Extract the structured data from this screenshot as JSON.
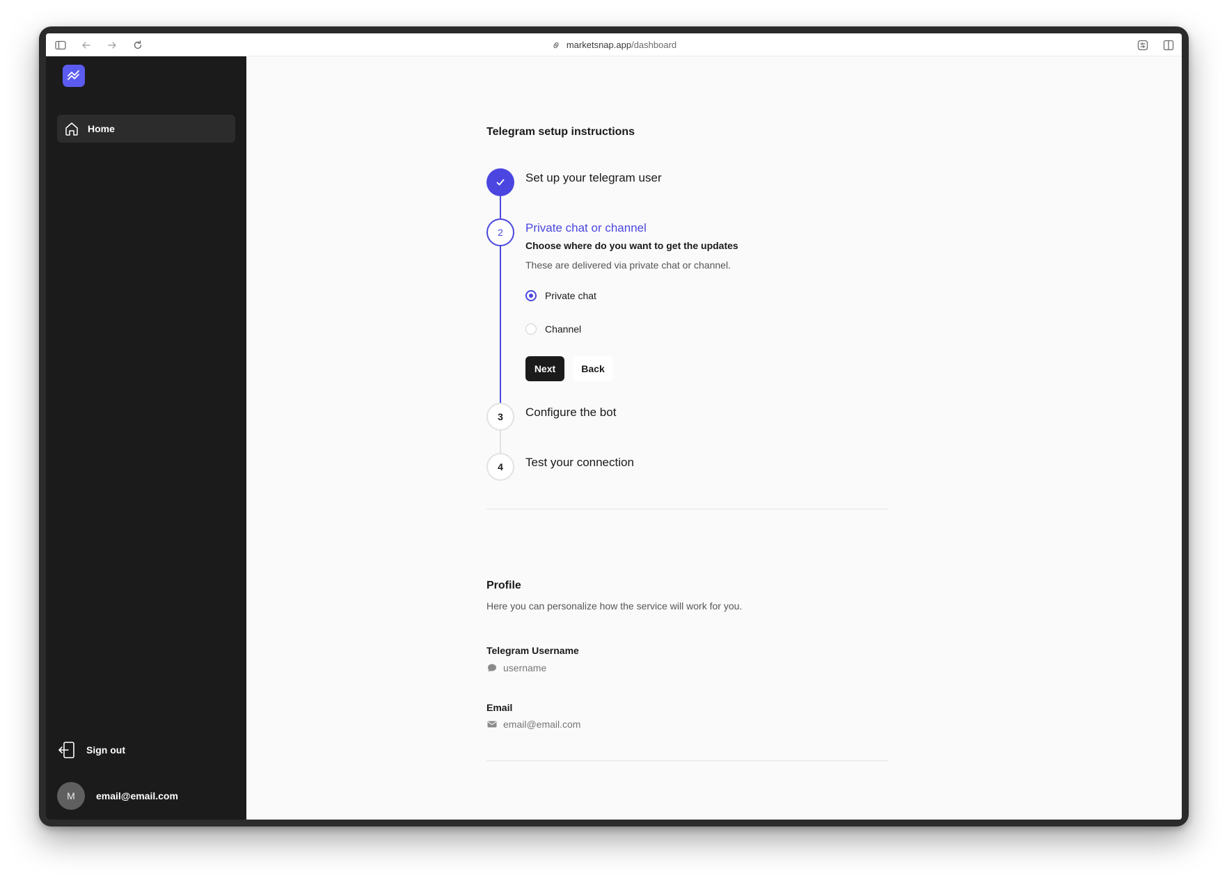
{
  "browser": {
    "url_host": "marketsnap.app",
    "url_path": "/dashboard",
    "icons": [
      "sidebar-toggle-icon",
      "back-arrow-icon",
      "forward-arrow-icon",
      "reload-icon",
      "link-icon",
      "extension-icon",
      "split-view-icon"
    ]
  },
  "sidebar": {
    "logo_icon": "chart-trend-icon",
    "nav": [
      {
        "label": "Home",
        "icon": "home-icon"
      }
    ],
    "signout_label": "Sign out",
    "user_initial": "M",
    "user_email": "email@email.com"
  },
  "setup": {
    "title": "Telegram setup instructions",
    "steps": [
      {
        "number": "1",
        "title": "Set up your telegram user",
        "state": "done"
      },
      {
        "number": "2",
        "title": "Private chat or channel",
        "state": "active"
      },
      {
        "number": "3",
        "title": "Configure the bot",
        "state": "todo"
      },
      {
        "number": "4",
        "title": "Test your connection",
        "state": "todo"
      }
    ],
    "active_step": {
      "heading": "Choose where do you want to get the updates",
      "description": "These are delivered via private chat or channel.",
      "options": [
        {
          "label": "Private chat",
          "selected": true
        },
        {
          "label": "Channel",
          "selected": false
        }
      ],
      "next_label": "Next",
      "back_label": "Back"
    }
  },
  "profile": {
    "title": "Profile",
    "description": "Here you can personalize how the service will work for you.",
    "telegram_label": "Telegram Username",
    "telegram_value": "username",
    "email_label": "Email",
    "email_value": "email@email.com"
  },
  "colors": {
    "accent": "#4b46e0",
    "sidebar_bg": "#1b1b1b",
    "logo_bg": "#5b5bf0"
  }
}
